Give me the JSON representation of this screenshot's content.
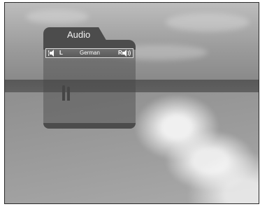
{
  "panel": {
    "title": "Audio",
    "left_channel": "L",
    "right_channel": "R",
    "language": "German"
  }
}
